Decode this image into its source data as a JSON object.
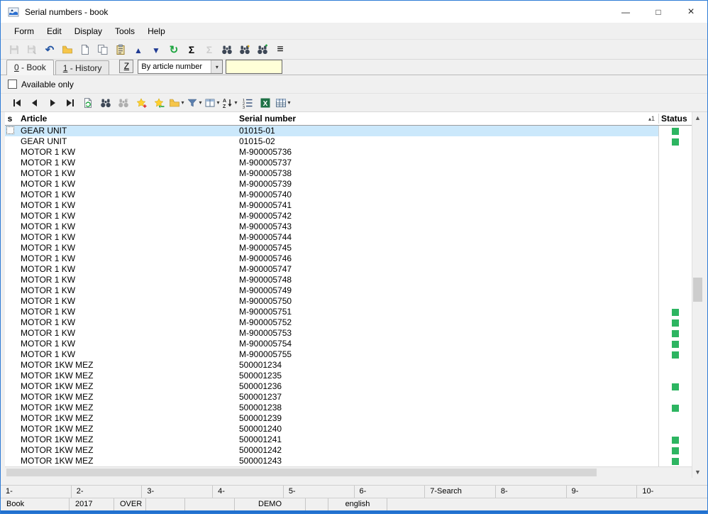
{
  "window": {
    "title": "Serial numbers - book"
  },
  "menu": {
    "items": [
      "Form",
      "Edit",
      "Display",
      "Tools",
      "Help"
    ]
  },
  "toolbar_main": {
    "icons": [
      {
        "name": "save-icon",
        "disabled": true
      },
      {
        "name": "save-as-icon",
        "disabled": true
      },
      {
        "name": "undo-icon"
      },
      {
        "name": "open-icon"
      },
      {
        "name": "new-icon"
      },
      {
        "name": "copy-icon"
      },
      {
        "name": "paste-icon"
      },
      {
        "name": "move-up-icon"
      },
      {
        "name": "move-down-icon"
      },
      {
        "name": "refresh-icon"
      },
      {
        "name": "sum-icon"
      },
      {
        "name": "sum-off-icon",
        "disabled": true
      },
      {
        "name": "find-icon"
      },
      {
        "name": "find-next-icon"
      },
      {
        "name": "find-dialog-icon"
      },
      {
        "name": "menu-icon"
      }
    ]
  },
  "tabs": [
    {
      "label": "0 - Book",
      "active": true
    },
    {
      "label": "1 - History",
      "active": false
    }
  ],
  "filter_bar": {
    "z_button": "Z",
    "sort_by": "By article number",
    "search_value": "",
    "input_color": "#ffffd8"
  },
  "options": {
    "available_only": "Available only",
    "checked": false
  },
  "toolbar_nav": {
    "icons": [
      {
        "name": "first-record-icon"
      },
      {
        "name": "prev-record-icon"
      },
      {
        "name": "next-record-icon"
      },
      {
        "name": "last-record-icon"
      },
      {
        "name": "refresh-view-icon"
      },
      {
        "name": "find-icon"
      },
      {
        "name": "find-next-icon",
        "disabled": true
      },
      {
        "name": "add-bookmark-icon"
      },
      {
        "name": "goto-bookmark-icon"
      },
      {
        "name": "open-document-icon",
        "dropdown": true
      },
      {
        "name": "filter-icon",
        "dropdown": true
      },
      {
        "name": "columns-icon",
        "dropdown": true
      },
      {
        "name": "sort-icon",
        "dropdown": true
      },
      {
        "name": "numbered-list-icon"
      },
      {
        "name": "export-excel-icon"
      },
      {
        "name": "grid-icon",
        "dropdown": true
      }
    ]
  },
  "table": {
    "columns": {
      "select": "s",
      "article": "Article",
      "serial": "Serial number",
      "status": "Status"
    },
    "sort_indicator": "1",
    "selected_row": 0,
    "status_color": "#2db561",
    "selection_color": "#cbe8fb",
    "rows": [
      {
        "article": "GEAR UNIT",
        "serial": "01015-01",
        "status": true
      },
      {
        "article": "GEAR UNIT",
        "serial": "01015-02",
        "status": true
      },
      {
        "article": "MOTOR 1 KW",
        "serial": "M-900005736",
        "status": false
      },
      {
        "article": "MOTOR 1 KW",
        "serial": "M-900005737",
        "status": false
      },
      {
        "article": "MOTOR 1 KW",
        "serial": "M-900005738",
        "status": false
      },
      {
        "article": "MOTOR 1 KW",
        "serial": "M-900005739",
        "status": false
      },
      {
        "article": "MOTOR 1 KW",
        "serial": "M-900005740",
        "status": false
      },
      {
        "article": "MOTOR 1 KW",
        "serial": "M-900005741",
        "status": false
      },
      {
        "article": "MOTOR 1 KW",
        "serial": "M-900005742",
        "status": false
      },
      {
        "article": "MOTOR 1 KW",
        "serial": "M-900005743",
        "status": false
      },
      {
        "article": "MOTOR 1 KW",
        "serial": "M-900005744",
        "status": false
      },
      {
        "article": "MOTOR 1 KW",
        "serial": "M-900005745",
        "status": false
      },
      {
        "article": "MOTOR 1 KW",
        "serial": "M-900005746",
        "status": false
      },
      {
        "article": "MOTOR 1 KW",
        "serial": "M-900005747",
        "status": false
      },
      {
        "article": "MOTOR 1 KW",
        "serial": "M-900005748",
        "status": false
      },
      {
        "article": "MOTOR 1 KW",
        "serial": "M-900005749",
        "status": false
      },
      {
        "article": "MOTOR 1 KW",
        "serial": "M-900005750",
        "status": false
      },
      {
        "article": "MOTOR 1 KW",
        "serial": "M-900005751",
        "status": true
      },
      {
        "article": "MOTOR 1 KW",
        "serial": "M-900005752",
        "status": true
      },
      {
        "article": "MOTOR 1 KW",
        "serial": "M-900005753",
        "status": true
      },
      {
        "article": "MOTOR 1 KW",
        "serial": "M-900005754",
        "status": true
      },
      {
        "article": "MOTOR 1 KW",
        "serial": "M-900005755",
        "status": true
      },
      {
        "article": "MOTOR 1KW MEZ",
        "serial": "500001234",
        "status": false
      },
      {
        "article": "MOTOR 1KW MEZ",
        "serial": "500001235",
        "status": false
      },
      {
        "article": "MOTOR 1KW MEZ",
        "serial": "500001236",
        "status": true
      },
      {
        "article": "MOTOR 1KW MEZ",
        "serial": "500001237",
        "status": false
      },
      {
        "article": "MOTOR 1KW MEZ",
        "serial": "500001238",
        "status": true
      },
      {
        "article": "MOTOR 1KW MEZ",
        "serial": "500001239",
        "status": false
      },
      {
        "article": "MOTOR 1KW MEZ",
        "serial": "500001240",
        "status": false
      },
      {
        "article": "MOTOR 1KW MEZ",
        "serial": "500001241",
        "status": true
      },
      {
        "article": "MOTOR 1KW MEZ",
        "serial": "500001242",
        "status": true
      },
      {
        "article": "MOTOR 1KW MEZ",
        "serial": "500001243",
        "status": true
      }
    ]
  },
  "function_keys": [
    "1-",
    "2-",
    "3-",
    "4-",
    "5-",
    "6-",
    "7-Search",
    "8-",
    "9-",
    "10-"
  ],
  "status_bar": {
    "cells": [
      "Book",
      "2017",
      "OVER",
      "",
      "",
      "DEMO",
      "",
      "english",
      ""
    ]
  }
}
